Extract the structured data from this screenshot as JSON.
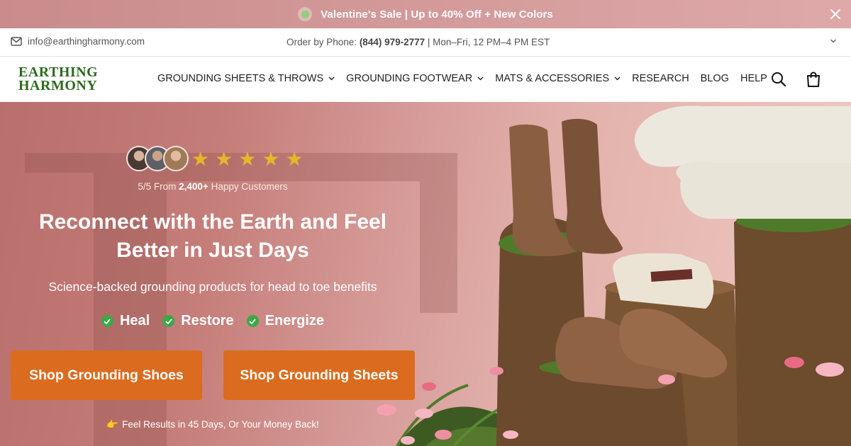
{
  "announcement": {
    "text": "Valentine's Sale | Up to 40% Off + New Colors",
    "close_icon": "close-icon"
  },
  "infobar": {
    "email": "info@earthingharmony.com",
    "phone_prefix": "Order by Phone: ",
    "phone_number": "(844) 979-2777",
    "phone_suffix": " | Mon–Fri, 12 PM–4 PM EST"
  },
  "header": {
    "logo_line1": "EARTHING",
    "logo_line2": "HARMONY",
    "nav": [
      {
        "label": "GROUNDING SHEETS & THROWS",
        "has_dropdown": true
      },
      {
        "label": "GROUNDING FOOTWEAR",
        "has_dropdown": true
      },
      {
        "label": "MATS & ACCESSORIES",
        "has_dropdown": true
      },
      {
        "label": "RESEARCH",
        "has_dropdown": false
      },
      {
        "label": "BLOG",
        "has_dropdown": false
      },
      {
        "label": "HELP",
        "has_dropdown": false
      }
    ]
  },
  "hero": {
    "stars": 5,
    "rating_prefix": "5/5 From ",
    "rating_count": "2,400+",
    "rating_suffix": " Happy Customers",
    "headline_line1": "Reconnect with the Earth and Feel",
    "headline_line2": "Better in Just Days",
    "subheadline": "Science-backed grounding products for head to toe benefits",
    "benefits": [
      "Heal",
      "Restore",
      "Energize"
    ],
    "button_shoes": "Shop Grounding Shoes",
    "button_sheets": "Shop Grounding Sheets",
    "guarantee_icon": "👉",
    "guarantee": "Feel Results in 45 Days, Or Your Money Back!"
  },
  "colors": {
    "accent": "#db6b1e",
    "logo_green": "#2d6a1f",
    "announce_bg": "#d49a9a",
    "check_green": "#3aa845",
    "star": "#e7b62c"
  }
}
